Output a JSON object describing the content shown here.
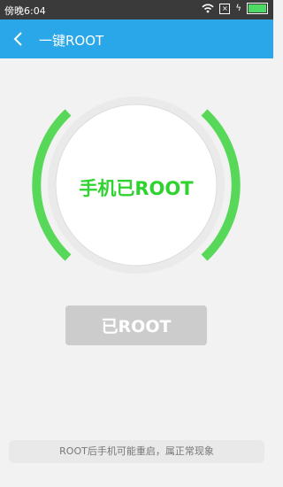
{
  "status_bar": {
    "time": "傍晚6:04"
  },
  "title_bar": {
    "title": "一键ROOT"
  },
  "status_circle": {
    "text": "手机已ROOT",
    "ring_color": "#58d858"
  },
  "main_button": {
    "label": "已ROOT"
  },
  "notice": {
    "text": "ROOT后手机可能重启，属正常现象"
  },
  "colors": {
    "header": "#2aa7e8",
    "accent": "#2fd32f",
    "button": "#cccccc",
    "background": "#f2f2f2"
  }
}
